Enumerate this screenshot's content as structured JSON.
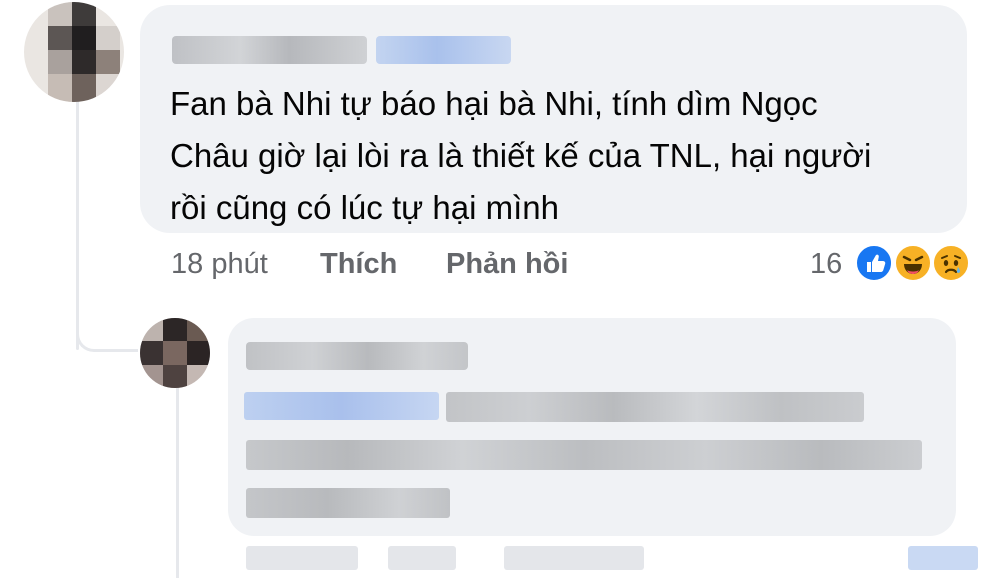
{
  "comment": {
    "text_lines": [
      "Fan bà Nhi tự báo hại bà Nhi, tính dìm Ngọc",
      "Châu giờ lại lòi ra là thiết kế của TNL, hại người",
      "rồi cũng có lúc tự hại mình"
    ],
    "timestamp": "18 phút",
    "like_label": "Thích",
    "reply_label": "Phản hồi",
    "reaction_count": "16",
    "reactions": [
      "like-icon",
      "haha-icon",
      "sad-icon"
    ]
  },
  "colors": {
    "bubble": "#f0f2f5",
    "text": "#050505",
    "muted": "#65676b",
    "like_blue": "#1877f2",
    "emoji_yellow": "#f7b125"
  }
}
